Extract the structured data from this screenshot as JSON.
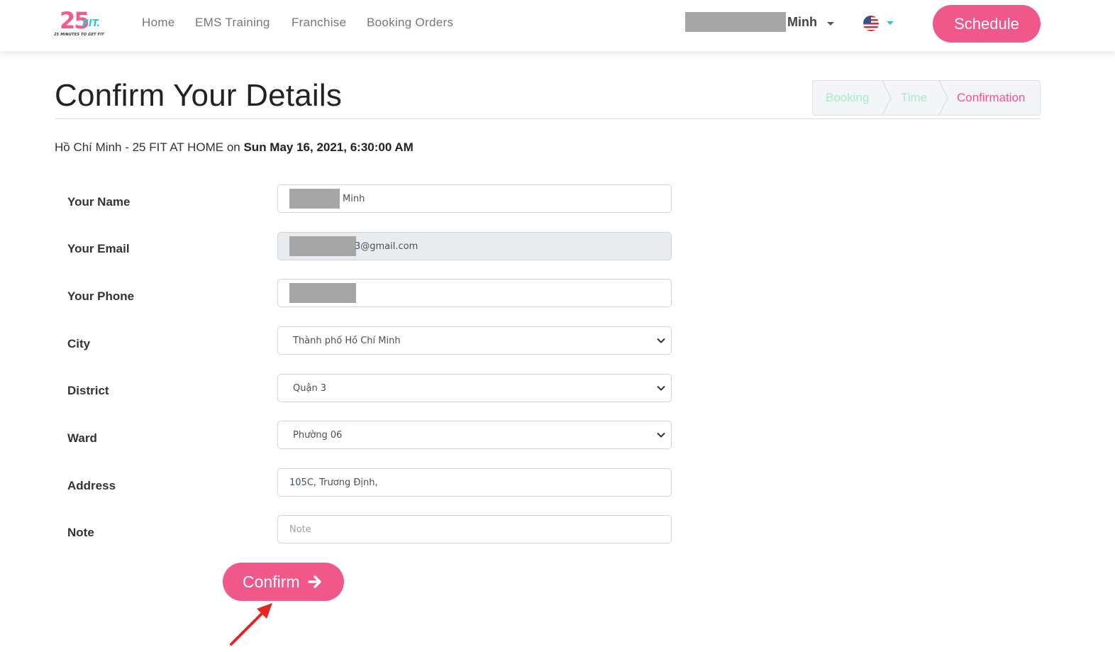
{
  "brand": {
    "logo_number": "25",
    "logo_word": "FIT.",
    "logo_tagline": "25 MINUTES TO GET FIT",
    "primary_color": "#f0588a",
    "accent_color": "#33c5c5"
  },
  "nav": {
    "links": [
      "Home",
      "EMS Training",
      "Franchise",
      "Booking Orders"
    ],
    "user_name": "Minh",
    "language_icon": "us-flag-icon",
    "schedule_label": "Schedule"
  },
  "page": {
    "title": "Confirm Your Details",
    "steps": [
      {
        "label": "Booking",
        "state": "done"
      },
      {
        "label": "Time",
        "state": "done"
      },
      {
        "label": "Confirmation",
        "state": "active"
      }
    ],
    "step_done_color": "#a8eac6",
    "step_active_color": "#f0588a",
    "booking_location": "Hồ Chí Minh - 25 FIT AT HOME",
    "booking_on": "on",
    "booking_datetime": "Sun May 16, 2021, 6:30:00 AM"
  },
  "form": {
    "name_label": "Your Name",
    "name_value_visible": "Minh",
    "email_label": "Your Email",
    "email_value_visible": "3@gmail.com",
    "phone_label": "Your Phone",
    "city_label": "City",
    "city_value": "Thành phố Hồ Chí Minh",
    "district_label": "District",
    "district_value": "Quận 3",
    "ward_label": "Ward",
    "ward_value": "Phường 06",
    "address_label": "Address",
    "address_value": "105C, Trương Định,",
    "note_label": "Note",
    "note_placeholder": "Note",
    "confirm_label": "Confirm"
  }
}
